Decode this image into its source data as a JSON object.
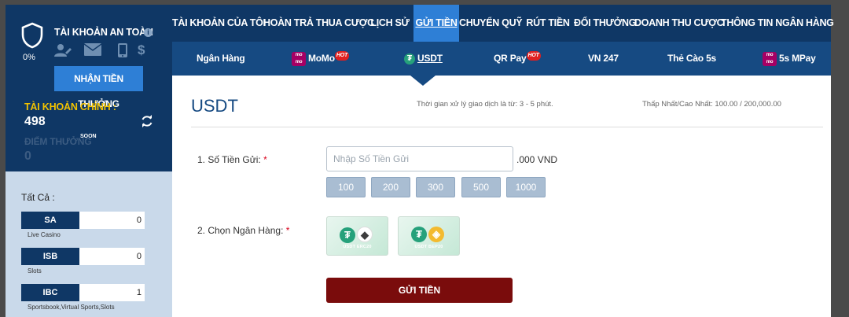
{
  "sidebar": {
    "safe_title": "TÀI KHOẢN AN TOÀN",
    "safety_percent": "0%",
    "claim_label": "NHẬN TIỀN THƯỞNG",
    "main_account_label": "TÀI KHOẢN CHÍNH :",
    "main_account_value": "498",
    "bonus_label": "ĐIỂM THƯỞNG",
    "bonus_badge": "SOON",
    "bonus_value": "0",
    "all_label": "Tất Cả :",
    "wallets": [
      {
        "code": "SA",
        "amount": "0",
        "desc": "Live Casino"
      },
      {
        "code": "ISB",
        "amount": "0",
        "desc": "Slots"
      },
      {
        "code": "IBC",
        "amount": "1",
        "desc": "Sportsbook,Virtual Sports,Slots"
      }
    ]
  },
  "topnav": [
    "TÀI KHOẢN CỦA TÔI",
    "HOÀN TRẢ THUA CƯỢC",
    "LỊCH SỬ",
    "GỬI TIỀN",
    "CHUYỂN QUỸ",
    "RÚT TIỀN",
    "ĐỔI THƯỞNG",
    "DOANH THU CƯỢC",
    "THÔNG TIN NGÂN HÀNG"
  ],
  "subnav": {
    "bank": "Ngân Hàng",
    "momo": "MoMo",
    "usdt": "USDT",
    "qrpay": "QR Pay",
    "vn247": "VN 247",
    "card": "Thẻ Cào 5s",
    "mpay": "5s MPay",
    "hot_badge": "HOT"
  },
  "content": {
    "title": "USDT",
    "processing_time": "Thời gian xử lý giao dịch là từ: 3 - 5 phút.",
    "limits": "Thấp Nhất/Cao Nhất: 100.00 / 200,000.00",
    "amount_label": "1. Số Tiền Gửi:",
    "amount_placeholder": "Nhập Số Tiền Gửi",
    "unit": ".000 VND",
    "quick_amounts": [
      "100",
      "200",
      "300",
      "500",
      "1000"
    ],
    "bank_label": "2. Chọn Ngân Hàng:",
    "required_mark": "*",
    "banks": [
      "USDT ERC20",
      "USDT BEP20"
    ],
    "submit_label": "GỬI TIỀN"
  },
  "colors": {
    "navy": "#0f3765",
    "active_blue": "#2e7fd6",
    "submit_red": "#7a0c0c",
    "gold": "#f2c200"
  }
}
